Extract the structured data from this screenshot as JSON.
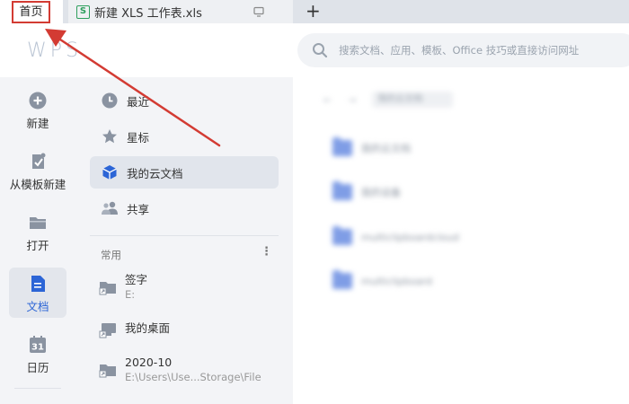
{
  "tabs": {
    "home_label": "首页",
    "file_label": "新建 XLS 工作表.xls",
    "file_icon_glyph": "S",
    "new_tab_glyph": "+"
  },
  "header": {
    "logo_text": "WPS",
    "search_placeholder": "搜索文档、应用、模板、Office 技巧或直接访问网址"
  },
  "rail": {
    "items": [
      {
        "label": "新建",
        "icon": "plus-circle-icon"
      },
      {
        "label": "从模板新建",
        "icon": "template-icon"
      },
      {
        "label": "打开",
        "icon": "folder-icon"
      },
      {
        "label": "文档",
        "icon": "document-icon",
        "active": true
      },
      {
        "label": "日历",
        "icon": "calendar-icon",
        "glyph": "31"
      }
    ]
  },
  "nav": {
    "items": [
      {
        "label": "最近",
        "icon": "clock-icon"
      },
      {
        "label": "星标",
        "icon": "star-icon"
      },
      {
        "label": "我的云文档",
        "icon": "cloud-cube-icon",
        "active": true
      },
      {
        "label": "共享",
        "icon": "people-icon"
      }
    ],
    "section_title": "常用",
    "section_more": "⋮",
    "common": [
      {
        "name": "签字",
        "path": "E:",
        "icon": "folder-shortcut-icon"
      },
      {
        "name": "我的桌面",
        "path": "",
        "icon": "desktop-shortcut-icon"
      },
      {
        "name": "2020-10",
        "path": "E:\\Users\\Use...Storage\\File",
        "icon": "folder-shortcut-icon"
      }
    ]
  },
  "main": {
    "back_glyph": "←",
    "forward_glyph": "→",
    "breadcrumb": "我的云文档",
    "files": [
      "我的云文档",
      "我的设备",
      "multiclipboardcloud",
      "multiclipboard"
    ]
  },
  "colors": {
    "accent": "#2c65d6",
    "highlight_red": "#d33b33",
    "xls_green": "#2e9f5d"
  }
}
